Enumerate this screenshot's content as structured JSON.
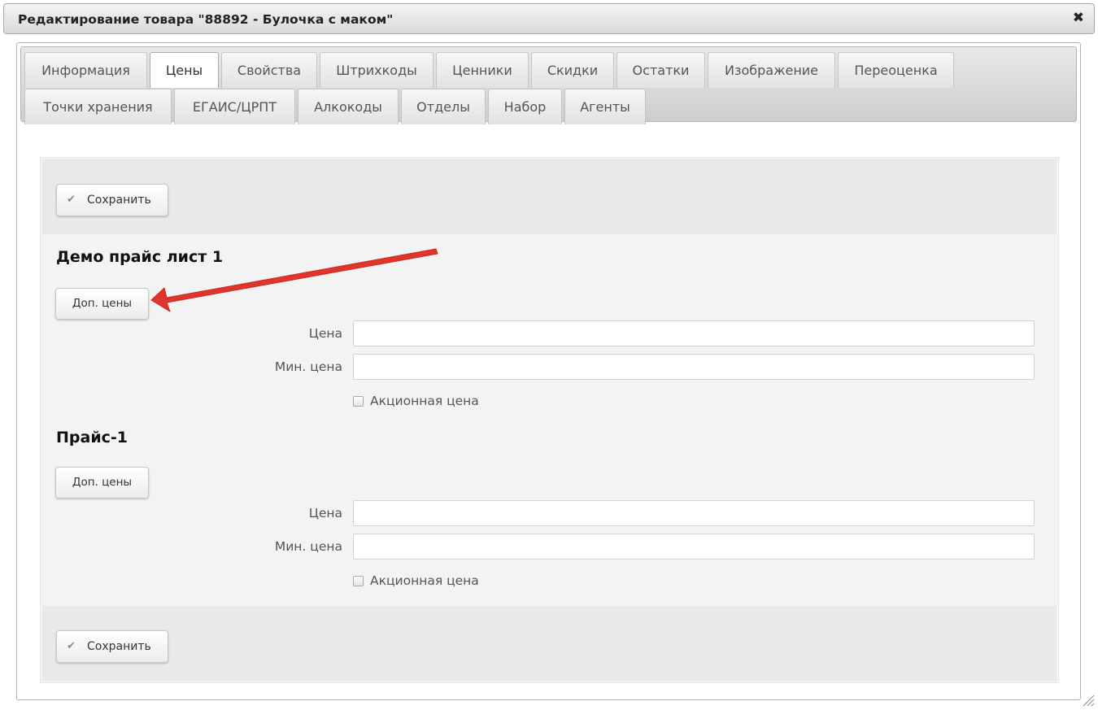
{
  "dialog": {
    "title": "Редактирование товара \"88892 - Булочка с маком\"",
    "close_symbol": "✖"
  },
  "tabs": [
    {
      "label": "Информация",
      "active": false
    },
    {
      "label": "Цены",
      "active": true
    },
    {
      "label": "Свойства",
      "active": false
    },
    {
      "label": "Штрихкоды",
      "active": false
    },
    {
      "label": "Ценники",
      "active": false
    },
    {
      "label": "Скидки",
      "active": false
    },
    {
      "label": "Остатки",
      "active": false
    },
    {
      "label": "Изображение",
      "active": false
    },
    {
      "label": "Переоценка",
      "active": false
    },
    {
      "label": "Точки хранения",
      "active": false
    },
    {
      "label": "ЕГАИС/ЦРПТ",
      "active": false
    },
    {
      "label": "Алкокоды",
      "active": false
    },
    {
      "label": "Отделы",
      "active": false
    },
    {
      "label": "Набор",
      "active": false
    },
    {
      "label": "Агенты",
      "active": false
    }
  ],
  "toolbar": {
    "save_label": "Сохранить",
    "save_icon": "✔"
  },
  "price_lists": [
    {
      "name": "Демо прайс лист 1",
      "extra_button": "Доп. цены",
      "price_label": "Цена",
      "price_value": "",
      "min_price_label": "Мин. цена",
      "min_price_value": "",
      "promo_label": "Акционная цена",
      "promo_checked": false
    },
    {
      "name": "Прайс-1",
      "extra_button": "Доп. цены",
      "price_label": "Цена",
      "price_value": "",
      "min_price_label": "Мин. цена",
      "min_price_value": "",
      "promo_label": "Акционная цена",
      "promo_checked": false
    }
  ],
  "colors": {
    "annotation_arrow": "#e0352f",
    "active_tab_bg": "#ffffff",
    "panel_bg": "#f3f3f3"
  },
  "icons": {
    "close": "close-icon",
    "save": "check-icon",
    "resize": "resize-grip-icon",
    "annotation": "red-arrow-annotation"
  }
}
